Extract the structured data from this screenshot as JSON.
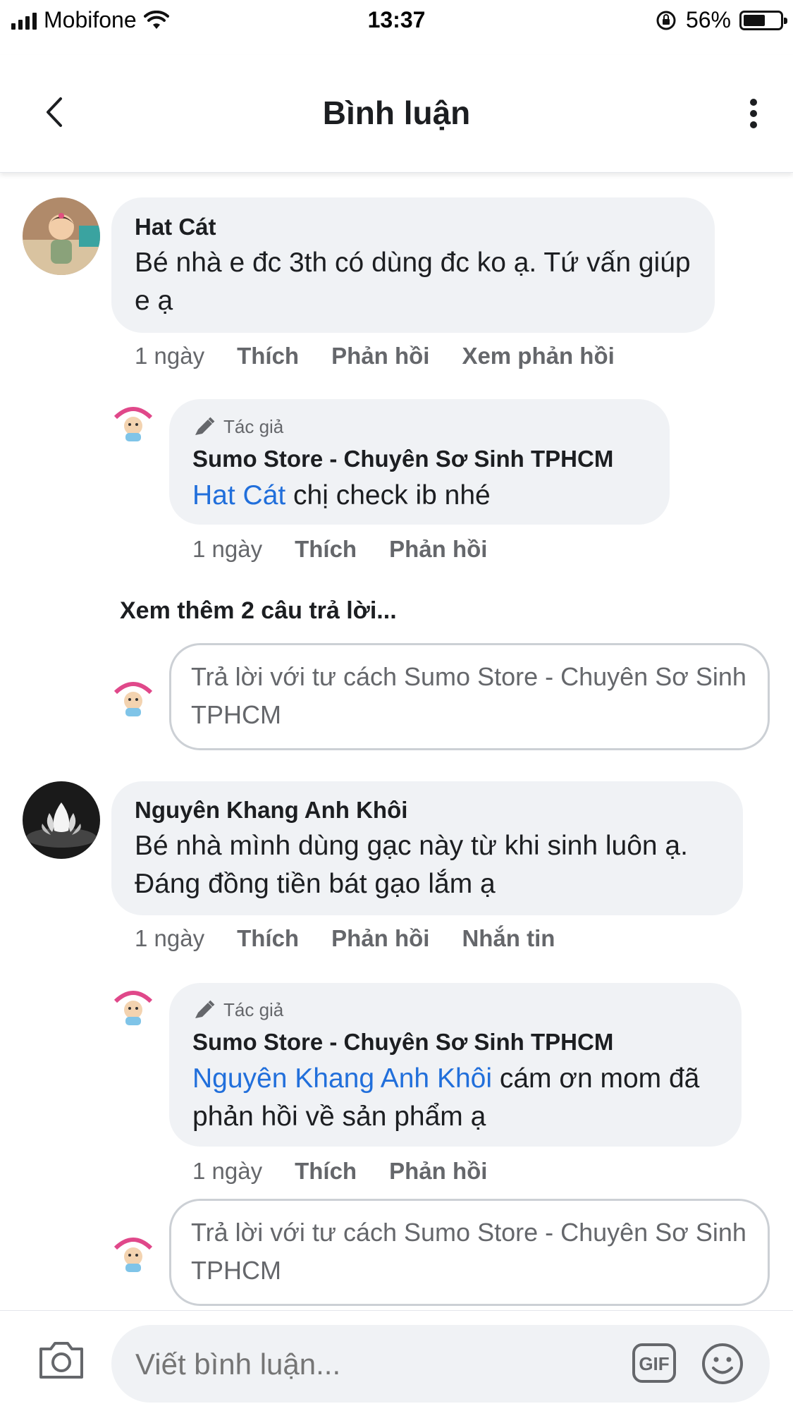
{
  "status_bar": {
    "carrier": "Mobifone",
    "time": "13:37",
    "battery_percent": "56%",
    "battery_level": 0.56
  },
  "header": {
    "title": "Bình luận",
    "back_icon": "chevron-left-icon",
    "more_icon": "more-vertical-icon"
  },
  "comments": [
    {
      "author": "Hat Cát",
      "text": "Bé nhà e đc 3th có dùng đc ko ạ. Tứ vấn giúp e ạ",
      "time": "1 ngày",
      "actions": [
        "Thích",
        "Phản hồi",
        "Xem phản hồi"
      ],
      "reply": {
        "badge": "Tác giả",
        "author": "Sumo Store - Chuyên Sơ Sinh TPHCM",
        "mention": "Hat Cát",
        "text": " chị check ib nhé",
        "time": "1 ngày",
        "actions": [
          "Thích",
          "Phản hồi"
        ]
      },
      "more_replies": "Xem thêm 2 câu trả lời...",
      "reply_placeholder": "Trả lời với tư cách Sumo Store - Chuyên Sơ Sinh TPHCM"
    },
    {
      "author": "Nguyên Khang Anh Khôi",
      "text": "Bé nhà mình dùng gạc này từ khi sinh luôn ạ. Đáng đồng tiền bát gạo lắm ạ",
      "time": "1 ngày",
      "actions": [
        "Thích",
        "Phản hồi",
        "Nhắn tin"
      ],
      "reply": {
        "badge": "Tác giả",
        "author": "Sumo Store - Chuyên Sơ Sinh TPHCM",
        "mention": "Nguyên Khang Anh Khôi",
        "text": " cám ơn mom đã phản hồi về sản phẩm ạ",
        "time": "1 ngày",
        "actions": [
          "Thích",
          "Phản hồi"
        ]
      },
      "reply_placeholder": "Trả lời với tư cách Sumo Store - Chuyên Sơ Sinh TPHCM"
    }
  ],
  "composer": {
    "placeholder": "Viết bình luận...",
    "gif_label": "GIF"
  },
  "colors": {
    "accent": "#216fdb",
    "bubble": "#f0f2f5",
    "secondary_text": "#65676b"
  }
}
